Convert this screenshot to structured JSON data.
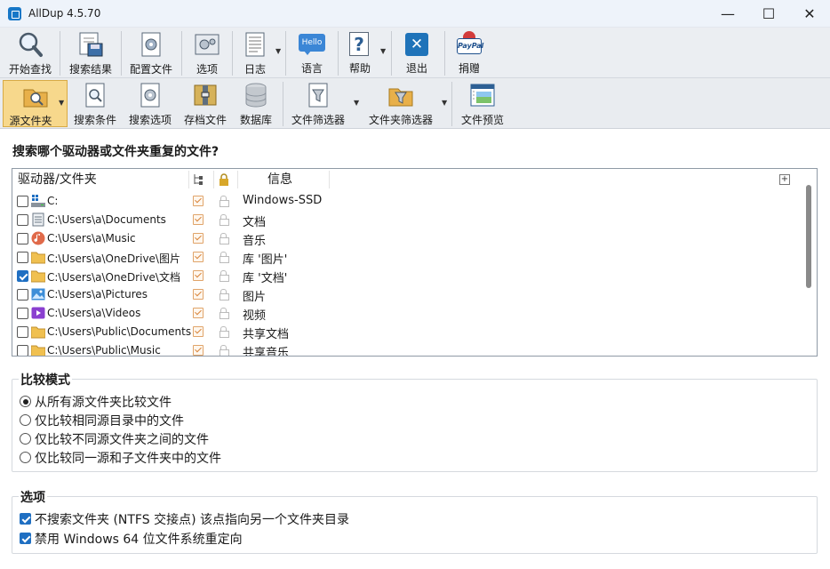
{
  "window": {
    "title": "AllDup 4.5.70",
    "minimize": "—",
    "maximize": "☐",
    "close": "✕"
  },
  "toolbar1": [
    {
      "label": "开始查找",
      "icon": "magnifier-icon"
    },
    {
      "label": "搜索结果",
      "icon": "save-results-icon"
    },
    {
      "label": "配置文件",
      "icon": "profile-icon"
    },
    {
      "label": "选项",
      "icon": "options-gear-icon"
    },
    {
      "label": "日志",
      "icon": "log-icon"
    },
    {
      "label": "语言",
      "icon": "hello-language-icon",
      "icon_text": "Hello"
    },
    {
      "label": "帮助",
      "icon": "help-icon",
      "icon_text": "?"
    },
    {
      "label": "退出",
      "icon": "exit-icon",
      "icon_text": "✕"
    },
    {
      "label": "捐赠",
      "icon": "paypal-donate-icon",
      "icon_text": "PayPal"
    }
  ],
  "toolbar2": [
    {
      "label": "源文件夹",
      "icon": "source-folder-icon",
      "active": true
    },
    {
      "label": "搜索条件",
      "icon": "search-criteria-icon"
    },
    {
      "label": "搜索选项",
      "icon": "search-options-icon"
    },
    {
      "label": "存档文件",
      "icon": "archive-icon"
    },
    {
      "label": "数据库",
      "icon": "database-icon"
    },
    {
      "label": "文件筛选器",
      "icon": "file-filter-icon"
    },
    {
      "label": "文件夹筛选器",
      "icon": "folder-filter-icon"
    },
    {
      "label": "文件预览",
      "icon": "file-preview-icon"
    }
  ],
  "main": {
    "question": "搜索哪个驱动器或文件夹重复的文件?",
    "list_headers": {
      "path": "驱动器/文件夹",
      "info": "信息",
      "add": "+"
    },
    "rows": [
      {
        "checked": false,
        "icon": "drive-icon",
        "path": "C:",
        "info": "Windows-SSD"
      },
      {
        "checked": false,
        "icon": "documents-icon",
        "path": "C:\\Users\\a\\Documents",
        "info": "文档"
      },
      {
        "checked": false,
        "icon": "music-icon",
        "path": "C:\\Users\\a\\Music",
        "info": "音乐"
      },
      {
        "checked": false,
        "icon": "folder-icon",
        "path": "C:\\Users\\a\\OneDrive\\图片",
        "info": "库 '图片'"
      },
      {
        "checked": true,
        "icon": "folder-icon",
        "path": "C:\\Users\\a\\OneDrive\\文档",
        "info": "库 '文档'"
      },
      {
        "checked": false,
        "icon": "pictures-icon",
        "path": "C:\\Users\\a\\Pictures",
        "info": "图片"
      },
      {
        "checked": false,
        "icon": "videos-icon",
        "path": "C:\\Users\\a\\Videos",
        "info": "视频"
      },
      {
        "checked": false,
        "icon": "folder-icon",
        "path": "C:\\Users\\Public\\Documents",
        "info": "共享文档"
      },
      {
        "checked": false,
        "icon": "folder-icon",
        "path": "C:\\Users\\Public\\Music",
        "info": "共享音乐"
      }
    ]
  },
  "compare_mode": {
    "title": "比较模式",
    "options": [
      {
        "label": "从所有源文件夹比较文件",
        "selected": true
      },
      {
        "label": "仅比较相同源目录中的文件",
        "selected": false
      },
      {
        "label": "仅比较不同源文件夹之间的文件",
        "selected": false
      },
      {
        "label": "仅比较同一源和子文件夹中的文件",
        "selected": false
      }
    ]
  },
  "options": {
    "title": "选项",
    "items": [
      {
        "label": "不搜索文件夹 (NTFS 交接点) 该点指向另一个文件夹目录",
        "checked": true
      },
      {
        "label": "禁用 Windows 64 位文件系统重定向",
        "checked": true
      }
    ]
  },
  "colors": {
    "accent": "#1f6fc2",
    "active_tab": "#f7d88c",
    "toolbar_bg": "#ebeef2"
  }
}
